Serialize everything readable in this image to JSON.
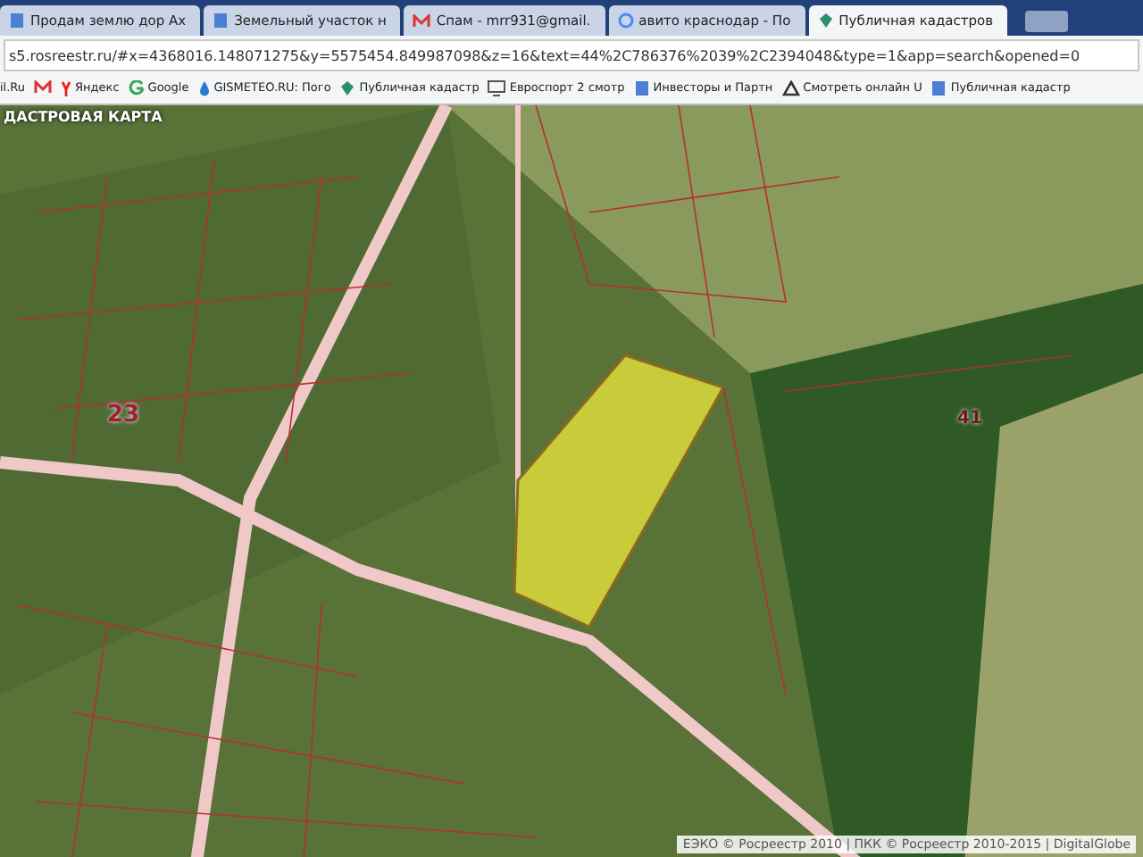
{
  "tabs": [
    {
      "label": "Продам землю дор Ах",
      "selected": false
    },
    {
      "label": "Земельный участок н",
      "selected": false
    },
    {
      "label": "Спам - mrr931@gmail.",
      "selected": false
    },
    {
      "label": "авито краснодар - По",
      "selected": false
    },
    {
      "label": "Публичная кадастров",
      "selected": true
    }
  ],
  "address": "s5.rosreestr.ru/#x=4368016.148071275&y=5575454.849987098&z=16&text=44%2C786376%2039%2C2394048&type=1&app=search&opened=0",
  "bookmarks": [
    "il.Ru",
    "Яндекс",
    "Google",
    "GISMETEO.RU: Пого",
    "Публичная кадастр",
    "Евроспорт 2 смотр",
    "Инвесторы и Партн",
    "Смотреть онлайн U",
    "Публичная кадастр"
  ],
  "map": {
    "title": "ДАСТРОВАЯ КАРТА",
    "quarters": [
      "23",
      "41"
    ],
    "attribution": "ЕЭКО © Росреестр 2010 | ПКК © Росреестр 2010-2015 | DigitalGlobe"
  }
}
